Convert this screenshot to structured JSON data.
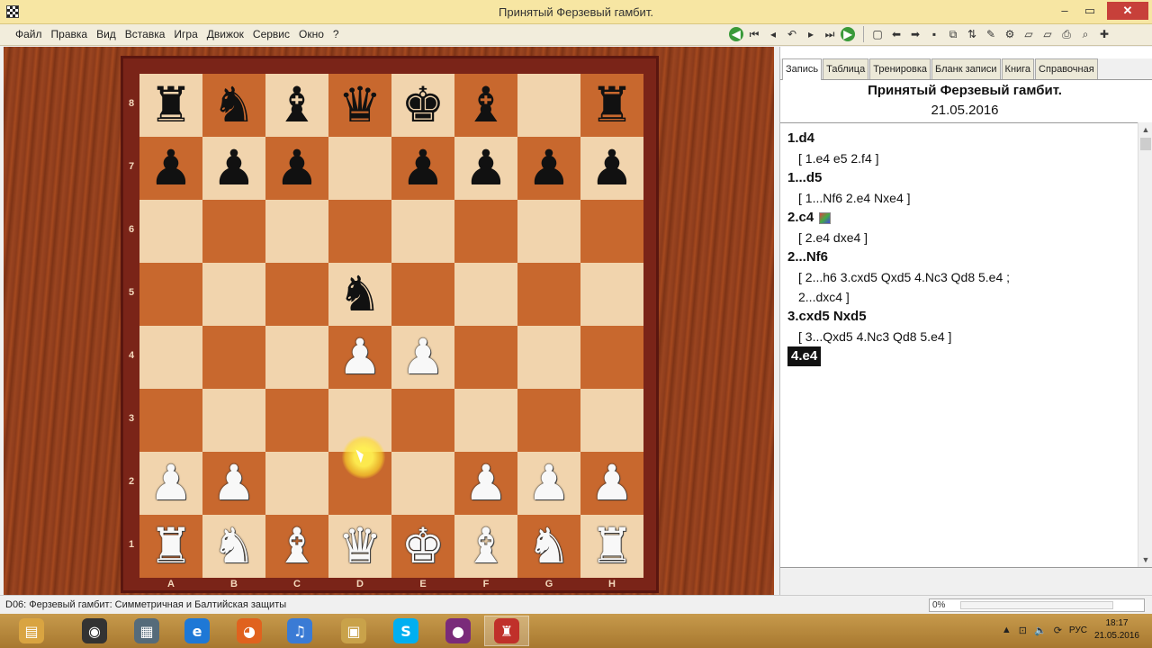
{
  "window": {
    "title": "Принятый Ферзевый гамбит.",
    "controls": [
      "–",
      "▭",
      "✕"
    ]
  },
  "menu": [
    "Файл",
    "Правка",
    "Вид",
    "Вставка",
    "Игра",
    "Движок",
    "Сервис",
    "Окно",
    "?"
  ],
  "toolbar_icons": [
    "go-start-icon",
    "first-move-icon",
    "prev-move-icon",
    "undo-icon",
    "next-move-icon",
    "last-move-icon",
    "go-end-icon",
    "new-doc-icon",
    "back-arrow-icon",
    "forward-arrow-icon",
    "save-icon",
    "copy-icon",
    "flip-icon",
    "analyze-icon",
    "settings-icon",
    "eraser-icon",
    "eraser2-icon",
    "print-icon",
    "search-icon",
    "add-icon"
  ],
  "board": {
    "ranks": [
      "8",
      "7",
      "6",
      "5",
      "4",
      "3",
      "2",
      "1"
    ],
    "files": [
      "A",
      "B",
      "C",
      "D",
      "E",
      "F",
      "G",
      "H"
    ],
    "position": [
      [
        "r",
        "n",
        "b",
        "q",
        "k",
        "b",
        "",
        "r"
      ],
      [
        "p",
        "p",
        "p",
        "",
        "p",
        "p",
        "p",
        "p"
      ],
      [
        "",
        "",
        "",
        "",
        "",
        "",
        "",
        ""
      ],
      [
        "",
        "",
        "",
        "n",
        "",
        "",
        "",
        ""
      ],
      [
        "",
        "",
        "",
        "P",
        "P",
        "",
        "",
        ""
      ],
      [
        "",
        "",
        "",
        "",
        "",
        "",
        "",
        ""
      ],
      [
        "P",
        "P",
        "",
        "",
        "",
        "P",
        "P",
        "P"
      ],
      [
        "R",
        "N",
        "B",
        "Q",
        "K",
        "B",
        "N",
        "R"
      ]
    ]
  },
  "tabs": [
    "Запись",
    "Таблица",
    "Тренировка",
    "Бланк записи",
    "Книга",
    "Справочная"
  ],
  "game": {
    "title": "Принятый Ферзевый гамбит.",
    "date": "21.05.2016"
  },
  "notation": [
    {
      "type": "move",
      "text": "1.d4"
    },
    {
      "type": "var",
      "text": "[ 1.e4  e5  2.f4 ]"
    },
    {
      "type": "move",
      "text": "1...d5"
    },
    {
      "type": "var",
      "text": "[ 1...Nf6  2.e4  Nxe4 ]"
    },
    {
      "type": "move",
      "text": "2.c4",
      "icon": true
    },
    {
      "type": "var",
      "text": "[ 2.e4  dxe4 ]"
    },
    {
      "type": "move",
      "text": "2...Nf6"
    },
    {
      "type": "var",
      "text": "[ 2...h6  3.cxd5  Qxd5  4.Nc3  Qd8  5.e4 ;"
    },
    {
      "type": "var",
      "text": "2...dxc4 ]"
    },
    {
      "type": "move",
      "text": "3.cxd5  Nxd5"
    },
    {
      "type": "var",
      "text": "[ 3...Qxd5  4.Nc3  Qd8  5.e4 ]"
    },
    {
      "type": "move",
      "text": "4.e4",
      "current": true
    }
  ],
  "status": {
    "opening": "D06: Ферзевый гамбит: Симметричная и Балтийская защиты",
    "progress_label": "0%",
    "progress": 0
  },
  "taskbar": {
    "apps": [
      {
        "name": "file-explorer",
        "color": "#d9a441",
        "glyph": "▤"
      },
      {
        "name": "media-app",
        "color": "#333333",
        "glyph": "◉"
      },
      {
        "name": "archive-app",
        "color": "#556b7a",
        "glyph": "▦"
      },
      {
        "name": "internet-explorer",
        "color": "#1e78d6",
        "glyph": "e"
      },
      {
        "name": "firefox",
        "color": "#e0621e",
        "glyph": "◕"
      },
      {
        "name": "volume-app",
        "color": "#3a7bd5",
        "glyph": "♫"
      },
      {
        "name": "app-7",
        "color": "#c9a24a",
        "glyph": "▣"
      },
      {
        "name": "skype",
        "color": "#00aff0",
        "glyph": "S"
      },
      {
        "name": "video-app",
        "color": "#7a2b7a",
        "glyph": "●"
      },
      {
        "name": "chess-app",
        "color": "#c0302a",
        "glyph": "♜"
      }
    ],
    "lang": "РУС",
    "time": "18:17",
    "date": "21.05.2016"
  }
}
